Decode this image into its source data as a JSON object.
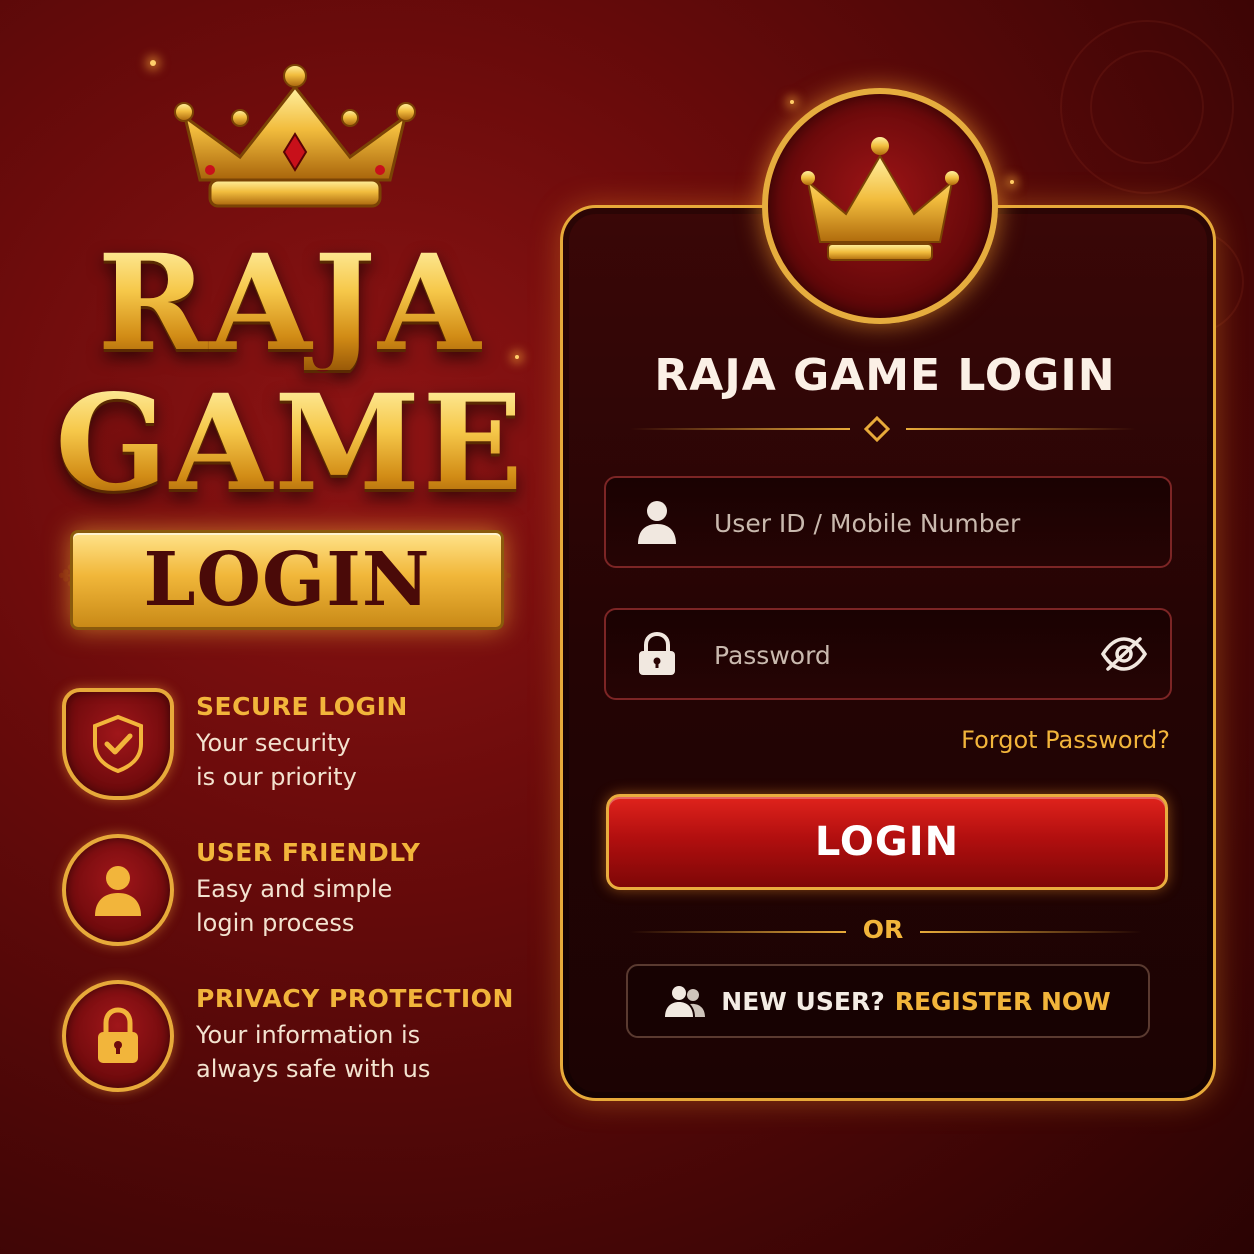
{
  "brand": {
    "line1": "RAJA",
    "line2": "GAME",
    "plaque": "LOGIN"
  },
  "features": [
    {
      "icon": "shield-check-icon",
      "title": "SECURE LOGIN",
      "line1": "Your security",
      "line2": "is our priority"
    },
    {
      "icon": "user-icon",
      "title": "USER FRIENDLY",
      "line1": "Easy and simple",
      "line2": "login process"
    },
    {
      "icon": "lock-icon",
      "title": "PRIVACY PROTECTION",
      "line1": "Your information is",
      "line2": "always safe with us"
    }
  ],
  "login_card": {
    "title": "RAJA GAME LOGIN",
    "user_field": {
      "placeholder": "User ID / Mobile Number",
      "value": "",
      "icon": "user-icon"
    },
    "password_field": {
      "placeholder": "Password",
      "value": "",
      "icon": "lock-icon",
      "toggle_icon": "eye-slash-icon"
    },
    "forgot_label": "Forgot Password?",
    "login_label": "LOGIN",
    "or_label": "OR",
    "register_question": "NEW USER?",
    "register_action": "REGISTER NOW",
    "register_icon": "users-icon"
  },
  "colors": {
    "gold": "#f2b53b",
    "deep_red": "#6a0b0b",
    "button_red": "#c4140f"
  }
}
